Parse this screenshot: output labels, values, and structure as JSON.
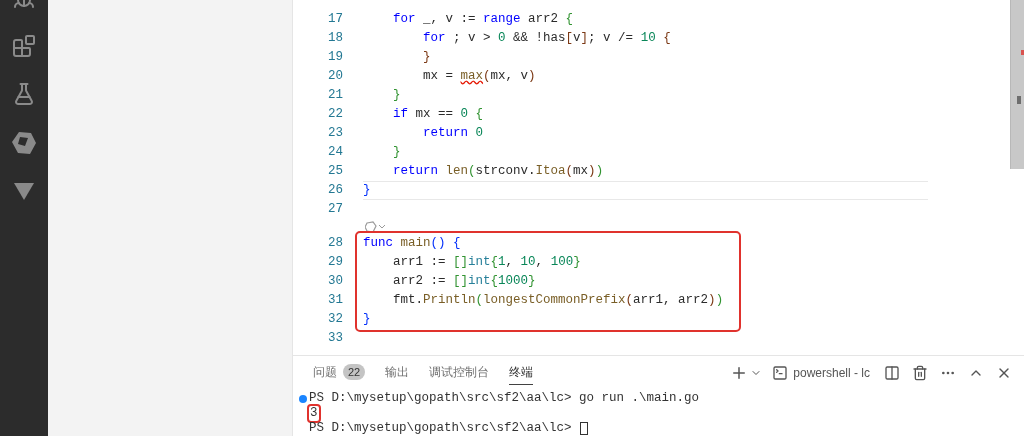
{
  "editor": {
    "lines": [
      {
        "number": "17",
        "tokens": [
          {
            "text": "    for",
            "kind": "keyword"
          },
          {
            "text": " _, v := ",
            "kind": "plain"
          },
          {
            "text": "range",
            "kind": "keyword"
          },
          {
            "text": " arr2 ",
            "kind": "plain"
          },
          {
            "text": "{",
            "kind": "bracket2"
          }
        ]
      },
      {
        "number": "18",
        "tokens": [
          {
            "text": "        for",
            "kind": "keyword"
          },
          {
            "text": " ; v > ",
            "kind": "plain"
          },
          {
            "text": "0",
            "kind": "number"
          },
          {
            "text": " && !has",
            "kind": "plain"
          },
          {
            "text": "[",
            "kind": "bracket3"
          },
          {
            "text": "v",
            "kind": "plain"
          },
          {
            "text": "]",
            "kind": "bracket3"
          },
          {
            "text": "; v /= ",
            "kind": "plain"
          },
          {
            "text": "10",
            "kind": "number"
          },
          {
            "text": " {",
            "kind": "bracket3"
          }
        ]
      },
      {
        "number": "19",
        "tokens": [
          {
            "text": "        }",
            "kind": "bracket3"
          }
        ]
      },
      {
        "number": "20",
        "tokens": [
          {
            "text": "        mx = ",
            "kind": "plain"
          },
          {
            "text": "max",
            "kind": "function",
            "error": true
          },
          {
            "text": "(",
            "kind": "bracket3"
          },
          {
            "text": "mx, v",
            "kind": "plain"
          },
          {
            "text": ")",
            "kind": "bracket3"
          }
        ]
      },
      {
        "number": "21",
        "tokens": [
          {
            "text": "    }",
            "kind": "bracket2"
          }
        ]
      },
      {
        "number": "22",
        "tokens": [
          {
            "text": "    if",
            "kind": "keyword"
          },
          {
            "text": " mx == ",
            "kind": "plain"
          },
          {
            "text": "0",
            "kind": "number"
          },
          {
            "text": " {",
            "kind": "bracket2"
          }
        ]
      },
      {
        "number": "23",
        "tokens": [
          {
            "text": "        return",
            "kind": "keyword"
          },
          {
            "text": " 0",
            "kind": "number"
          }
        ]
      },
      {
        "number": "24",
        "tokens": [
          {
            "text": "    }",
            "kind": "bracket2"
          }
        ]
      },
      {
        "number": "25",
        "tokens": [
          {
            "text": "    return",
            "kind": "keyword"
          },
          {
            "text": " len",
            "kind": "function"
          },
          {
            "text": "(",
            "kind": "bracket2"
          },
          {
            "text": "strconv.",
            "kind": "plain"
          },
          {
            "text": "Itoa",
            "kind": "function"
          },
          {
            "text": "(",
            "kind": "bracket3"
          },
          {
            "text": "mx",
            "kind": "plain"
          },
          {
            "text": ")",
            "kind": "bracket3"
          },
          {
            "text": ")",
            "kind": "bracket2"
          }
        ]
      },
      {
        "number": "26",
        "current": true,
        "tokens": [
          {
            "text": "}",
            "kind": "bracket1"
          }
        ]
      },
      {
        "number": "27"
      },
      {
        "number": "28",
        "codelens": true,
        "boxed": true,
        "tokens": [
          {
            "text": "func",
            "kind": "keyword"
          },
          {
            "text": " main",
            "kind": "function"
          },
          {
            "text": "()",
            "kind": "bracket1"
          },
          {
            "text": " {",
            "kind": "bracket1"
          }
        ]
      },
      {
        "number": "29",
        "boxed": true,
        "tokens": [
          {
            "text": "    arr1 := ",
            "kind": "plain"
          },
          {
            "text": "[]",
            "kind": "bracket2"
          },
          {
            "text": "int",
            "kind": "type"
          },
          {
            "text": "{",
            "kind": "bracket2"
          },
          {
            "text": "1",
            "kind": "number"
          },
          {
            "text": ", ",
            "kind": "plain"
          },
          {
            "text": "10",
            "kind": "number"
          },
          {
            "text": ", ",
            "kind": "plain"
          },
          {
            "text": "100",
            "kind": "number"
          },
          {
            "text": "}",
            "kind": "bracket2"
          }
        ]
      },
      {
        "number": "30",
        "boxed": true,
        "tokens": [
          {
            "text": "    arr2 := ",
            "kind": "plain"
          },
          {
            "text": "[]",
            "kind": "bracket2"
          },
          {
            "text": "int",
            "kind": "type"
          },
          {
            "text": "{",
            "kind": "bracket2"
          },
          {
            "text": "1000",
            "kind": "number"
          },
          {
            "text": "}",
            "kind": "bracket2"
          }
        ]
      },
      {
        "number": "31",
        "boxed": true,
        "tokens": [
          {
            "text": "    fmt.",
            "kind": "plain"
          },
          {
            "text": "Println",
            "kind": "function"
          },
          {
            "text": "(",
            "kind": "bracket2"
          },
          {
            "text": "longestCommonPrefix",
            "kind": "function"
          },
          {
            "text": "(",
            "kind": "bracket3"
          },
          {
            "text": "arr1, arr2",
            "kind": "plain"
          },
          {
            "text": ")",
            "kind": "bracket3"
          },
          {
            "text": ")",
            "kind": "bracket2"
          }
        ]
      },
      {
        "number": "32",
        "boxed": true,
        "tokens": [
          {
            "text": "}",
            "kind": "bracket1"
          }
        ]
      },
      {
        "number": "33"
      }
    ]
  },
  "panel": {
    "tabs": [
      {
        "label": "问题",
        "badge": "22",
        "selected": false
      },
      {
        "label": "输出",
        "selected": false
      },
      {
        "label": "调试控制台",
        "selected": false
      },
      {
        "label": "终端",
        "selected": true
      }
    ],
    "terminal_profile": "powershell - lc",
    "terminal_lines": [
      {
        "prompt": "PS D:\\mysetup\\gopath\\src\\sf2\\aa\\lc> ",
        "command": "go run .\\main.go",
        "dot": true
      },
      {
        "output": "3",
        "boxed": true
      },
      {
        "prompt": "PS D:\\mysetup\\gopath\\src\\sf2\\aa\\lc> ",
        "cursor": true
      }
    ]
  }
}
